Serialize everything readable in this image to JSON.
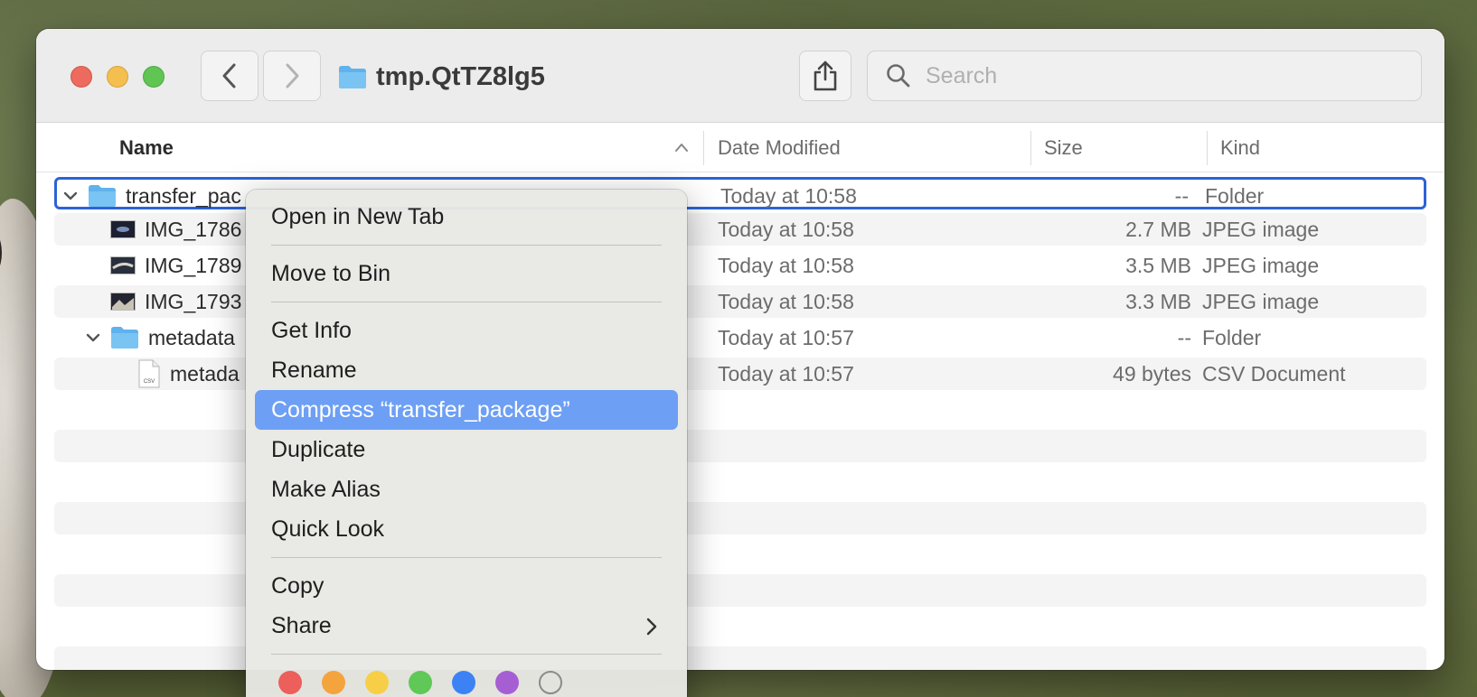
{
  "window": {
    "title": "tmp.QtTZ8lg5"
  },
  "search": {
    "placeholder": "Search"
  },
  "columns": {
    "name": "Name",
    "date": "Date Modified",
    "size": "Size",
    "kind": "Kind"
  },
  "files": [
    {
      "name": "transfer_package",
      "visible_name": "transfer_pac",
      "date": "Today at 10:58",
      "size": "--",
      "kind": "Folder",
      "icon": "folder-icon",
      "expanded": true
    },
    {
      "name": "IMG_1786",
      "visible_name": "IMG_1786",
      "date": "Today at 10:58",
      "size": "2.7 MB",
      "kind": "JPEG image",
      "icon": "image-thumbnail-icon"
    },
    {
      "name": "IMG_1789",
      "visible_name": "IMG_1789",
      "date": "Today at 10:58",
      "size": "3.5 MB",
      "kind": "JPEG image",
      "icon": "image-thumbnail-icon"
    },
    {
      "name": "IMG_1793",
      "visible_name": "IMG_1793",
      "date": "Today at 10:58",
      "size": "3.3 MB",
      "kind": "JPEG image",
      "icon": "image-thumbnail-icon"
    },
    {
      "name": "metadata",
      "visible_name": "metadata",
      "date": "Today at 10:57",
      "size": "--",
      "kind": "Folder",
      "icon": "folder-icon",
      "expanded": true
    },
    {
      "name": "metadata",
      "visible_name": "metada",
      "date": "Today at 10:57",
      "size": "49 bytes",
      "kind": "CSV Document",
      "icon": "csv-file-icon",
      "icon_label": "CSV"
    }
  ],
  "context_menu": {
    "items": [
      "Open in New Tab",
      "Move to Bin",
      "Get Info",
      "Rename",
      "Compress “transfer_package”",
      "Duplicate",
      "Make Alias",
      "Quick Look",
      "Copy",
      "Share"
    ],
    "highlighted": "Compress “transfer_package”",
    "tag_colors": [
      "#ec5f5a",
      "#f3a43d",
      "#f6cf47",
      "#5fc857",
      "#3c82f5",
      "#a65fd3",
      "none"
    ]
  },
  "colors": {
    "selection_border": "#2c63d6",
    "menu_highlight": "#6d9ff5",
    "folder_blue": "#5fb2ec"
  }
}
